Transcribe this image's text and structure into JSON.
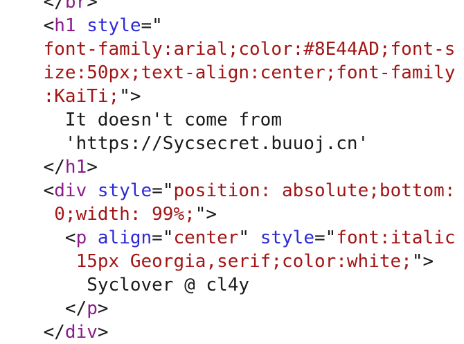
{
  "colors": {
    "tag": "#8a1c8a",
    "attr": "#2c2ad8",
    "string": "#a31515",
    "text": "#1a1a1a",
    "background": "#ffffff"
  },
  "lines": [
    [
      {
        "k": "punct",
        "t": "    </"
      },
      {
        "k": "tag",
        "t": "br"
      },
      {
        "k": "punct",
        "t": ">"
      }
    ],
    [
      {
        "k": "punct",
        "t": "    <"
      },
      {
        "k": "tag",
        "t": "h1"
      },
      {
        "k": "punct",
        "t": " "
      },
      {
        "k": "attr",
        "t": "style"
      },
      {
        "k": "punct",
        "t": "=\""
      }
    ],
    [
      {
        "k": "str",
        "t": "    font-family:arial;color:#8E44AD;font-s"
      }
    ],
    [
      {
        "k": "str",
        "t": "    ize:50px;text-align:center;font-family"
      }
    ],
    [
      {
        "k": "str",
        "t": "    :KaiTi;"
      },
      {
        "k": "punct",
        "t": "\">"
      }
    ],
    [
      {
        "k": "text",
        "t": "      It doesn't come from"
      }
    ],
    [
      {
        "k": "text",
        "t": "      'https://Sycsecret.buuoj.cn'"
      }
    ],
    [
      {
        "k": "punct",
        "t": "    </"
      },
      {
        "k": "tag",
        "t": "h1"
      },
      {
        "k": "punct",
        "t": ">"
      }
    ],
    [
      {
        "k": "punct",
        "t": "    <"
      },
      {
        "k": "tag",
        "t": "div"
      },
      {
        "k": "punct",
        "t": " "
      },
      {
        "k": "attr",
        "t": "style"
      },
      {
        "k": "punct",
        "t": "=\""
      },
      {
        "k": "str",
        "t": "position: absolute;bottom:"
      }
    ],
    [
      {
        "k": "str",
        "t": "     0;width: 99%;"
      },
      {
        "k": "punct",
        "t": "\">"
      }
    ],
    [
      {
        "k": "punct",
        "t": "      <"
      },
      {
        "k": "tag",
        "t": "p"
      },
      {
        "k": "punct",
        "t": " "
      },
      {
        "k": "attr",
        "t": "align"
      },
      {
        "k": "punct",
        "t": "=\""
      },
      {
        "k": "str",
        "t": "center"
      },
      {
        "k": "punct",
        "t": "\" "
      },
      {
        "k": "attr",
        "t": "style"
      },
      {
        "k": "punct",
        "t": "=\""
      },
      {
        "k": "str",
        "t": "font:italic"
      }
    ],
    [
      {
        "k": "str",
        "t": "       15px Georgia,serif;color:white;"
      },
      {
        "k": "punct",
        "t": "\">"
      }
    ],
    [
      {
        "k": "text",
        "t": "        Syclover @ cl4y"
      }
    ],
    [
      {
        "k": "punct",
        "t": "      </"
      },
      {
        "k": "tag",
        "t": "p"
      },
      {
        "k": "punct",
        "t": ">"
      }
    ],
    [
      {
        "k": "punct",
        "t": "    </"
      },
      {
        "k": "tag",
        "t": "div"
      },
      {
        "k": "punct",
        "t": ">"
      }
    ]
  ]
}
